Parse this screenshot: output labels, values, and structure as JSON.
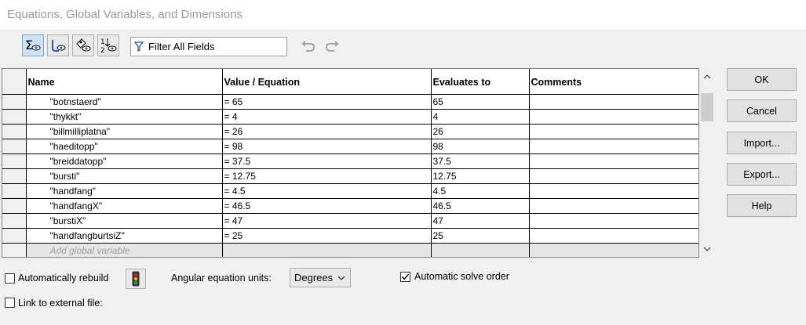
{
  "window": {
    "title": "Equations, Global Variables, and Dimensions"
  },
  "toolbar": {
    "buttons": [
      {
        "name": "equation-view-icon"
      },
      {
        "name": "sketch-equation-view-icon"
      },
      {
        "name": "dimension-view-icon"
      },
      {
        "name": "ordered-view-icon"
      }
    ],
    "filter_text": "Filter All Fields",
    "undo_icon": "undo-icon",
    "redo_icon": "redo-icon"
  },
  "grid": {
    "columns": [
      "Name",
      "Value / Equation",
      "Evaluates to",
      "Comments"
    ],
    "rows": [
      {
        "name": "\"botnstaerd\"",
        "value": "= 65",
        "evaluates": "65",
        "comments": ""
      },
      {
        "name": "\"thykkt\"",
        "value": "= 4",
        "evaluates": "4",
        "comments": ""
      },
      {
        "name": "\"billmilliplatna\"",
        "value": "= 26",
        "evaluates": "26",
        "comments": ""
      },
      {
        "name": "\"haeditopp\"",
        "value": "= 98",
        "evaluates": "98",
        "comments": ""
      },
      {
        "name": "\"breiddatopp\"",
        "value": "= 37.5",
        "evaluates": "37.5",
        "comments": ""
      },
      {
        "name": "\"bursti\"",
        "value": "= 12.75",
        "evaluates": "12.75",
        "comments": ""
      },
      {
        "name": "\"handfang\"",
        "value": "= 4.5",
        "evaluates": "4.5",
        "comments": ""
      },
      {
        "name": "\"handfangX\"",
        "value": "= 46.5",
        "evaluates": "46.5",
        "comments": ""
      },
      {
        "name": "\"burstiX\"",
        "value": "= 47",
        "evaluates": "47",
        "comments": ""
      },
      {
        "name": "\"handfangburtsiZ\"",
        "value": "= 25",
        "evaluates": "25",
        "comments": ""
      }
    ],
    "add_placeholder": "Add global variable"
  },
  "side_buttons": {
    "ok": "OK",
    "cancel": "Cancel",
    "import": "Import...",
    "export": "Export...",
    "help": "Help"
  },
  "footer": {
    "auto_rebuild_label": "Automatically rebuild",
    "auto_rebuild_checked": false,
    "angular_units_label": "Angular equation units:",
    "angular_units_value": "Degrees",
    "auto_solve_label": "Automatic solve order",
    "auto_solve_checked": true,
    "link_external_label": "Link to external file:",
    "link_external_checked": false
  }
}
